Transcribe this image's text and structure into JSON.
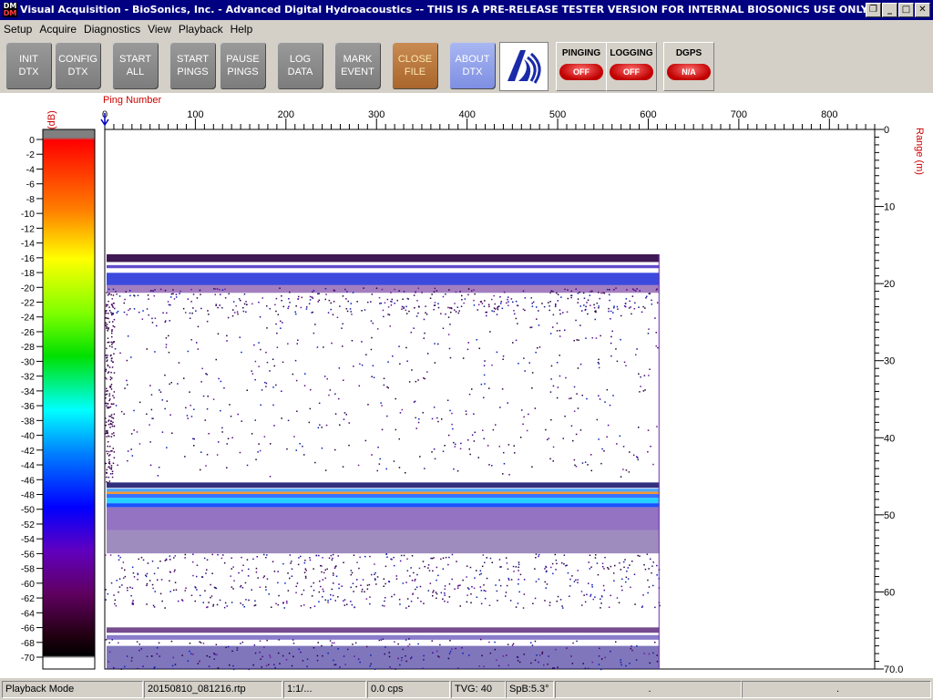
{
  "window": {
    "title": "Visual Acquisition  -  BioSonics, Inc.  -  Advanced Digital Hydroacoustics  -- THIS IS A PRE-RELEASE TESTER VERSION FOR INTERNAL BIOSONICS USE ONLY",
    "icon_top": "DM",
    "icon_bottom": "DM",
    "buttons": [
      "restore-icon",
      "minimize-icon",
      "maximize-icon",
      "close-icon"
    ]
  },
  "menu": [
    "Setup",
    "Acquire",
    "Diagnostics",
    "View",
    "Playback",
    "Help"
  ],
  "toolbar": {
    "buttons": [
      {
        "label": "INIT\nDTX",
        "style": "gray"
      },
      {
        "label": "CONFIG\nDTX",
        "style": "gray"
      },
      {
        "label": "START\nALL",
        "style": "gray"
      },
      {
        "label": "START\nPINGS",
        "style": "gray"
      },
      {
        "label": "PAUSE\nPINGS",
        "style": "gray"
      },
      {
        "label": "LOG\nDATA",
        "style": "gray"
      },
      {
        "label": "MARK\nEVENT",
        "style": "gray"
      },
      {
        "label": "CLOSE\nFILE",
        "style": "close"
      },
      {
        "label": "ABOUT\nDTX",
        "style": "about"
      }
    ],
    "indicators": [
      {
        "title": "PINGING",
        "state": "OFF"
      },
      {
        "title": "LOGGING",
        "state": "OFF"
      },
      {
        "title": "DGPS",
        "state": "N/A"
      }
    ],
    "logo_icon": "biosonics-logo-icon"
  },
  "echogram": {
    "x_axis_label": "Ping Number",
    "x_ticks": [
      "0",
      "100",
      "200",
      "300",
      "400",
      "500",
      "600",
      "700",
      "800"
    ],
    "y_axis_label": "Range (m)",
    "y_ticks": [
      "0",
      "10",
      "20",
      "30",
      "40",
      "50",
      "60",
      "70.0"
    ],
    "amplitude_label": "Amplitude (dB)",
    "amplitude_ticks": [
      "0",
      "-2",
      "-4",
      "-6",
      "-8",
      "-10",
      "-12",
      "-14",
      "-16",
      "-18",
      "-20",
      "-22",
      "-24",
      "-26",
      "-28",
      "-30",
      "-32",
      "-34",
      "-36",
      "-38",
      "-40",
      "-42",
      "-44",
      "-46",
      "-48",
      "-50",
      "-52",
      "-54",
      "-56",
      "-58",
      "-60",
      "-62",
      "-64",
      "-66",
      "-68",
      "-70"
    ],
    "x_range": [
      0,
      850
    ],
    "y_range": [
      0,
      70
    ],
    "data_extent_pings": 612,
    "cursor_ping": 0,
    "colors": {
      "axis_label": "#cc0000"
    }
  },
  "status": {
    "mode": "Playback Mode",
    "file": "20150810_081216.rtp",
    "ratio": "1:1/...",
    "rate": "0.0 cps",
    "tvg": "TVG: 40",
    "spb": "SpB:5.3°",
    "extra1": ".",
    "extra2": "."
  }
}
